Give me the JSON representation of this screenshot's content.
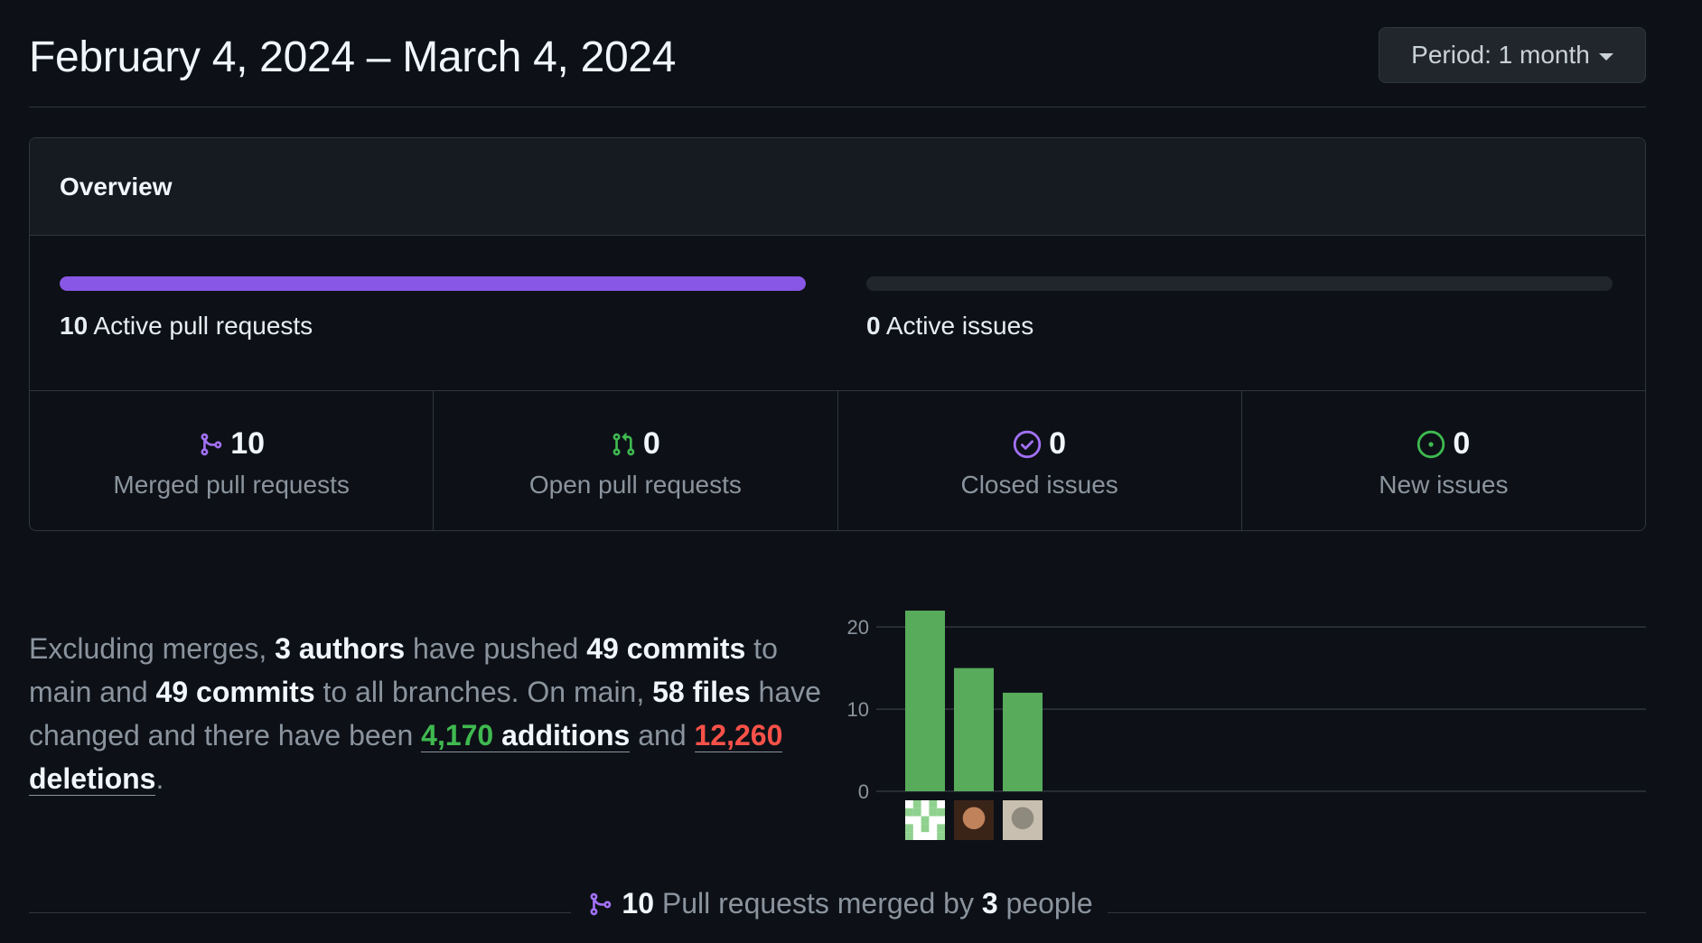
{
  "header": {
    "date_range": "February 4, 2024 – March 4, 2024",
    "period_label": "Period: 1 month"
  },
  "overview": {
    "title": "Overview",
    "active_prs": {
      "count": "10",
      "label": "Active pull requests",
      "fill_fraction": 1.0
    },
    "active_issues": {
      "count": "0",
      "label": "Active issues",
      "fill_fraction": 0.0
    },
    "stats": [
      {
        "icon": "git-merge-icon",
        "value": "10",
        "label": "Merged pull requests",
        "color": "#a371f7"
      },
      {
        "icon": "git-pull-request-icon",
        "value": "0",
        "label": "Open pull requests",
        "color": "#3fb950"
      },
      {
        "icon": "issue-closed-icon",
        "value": "0",
        "label": "Closed issues",
        "color": "#a371f7"
      },
      {
        "icon": "issue-opened-icon",
        "value": "0",
        "label": "New issues",
        "color": "#3fb950"
      }
    ]
  },
  "summary": {
    "t1": "Excluding merges, ",
    "authors": "3 authors",
    "t2": " have pushed ",
    "commits_main": "49 commits",
    "t3": " to main and ",
    "commits_all": "49 commits",
    "t4": " to all branches. On main, ",
    "files": "58 files",
    "t5": " have changed and there have been ",
    "additions_num": "4,170",
    "additions_word": " additions",
    "t6": " and ",
    "deletions_num": "12,260",
    "deletions_word": " deletions",
    "t7": "."
  },
  "chart_data": {
    "type": "bar",
    "categories": [
      "author-1",
      "author-2",
      "author-3"
    ],
    "values": [
      22,
      15,
      12
    ],
    "ylim": [
      0,
      22
    ],
    "yticks": [
      0,
      10,
      20
    ],
    "grid": true,
    "bar_color": "#57ab5a"
  },
  "footer": {
    "count": "10",
    "t1": " Pull requests merged by ",
    "people": "3",
    "t2": " people"
  },
  "colors": {
    "background": "#0d1117",
    "accent_purple": "#8957e5",
    "green": "#3fb950",
    "red": "#f85149"
  }
}
